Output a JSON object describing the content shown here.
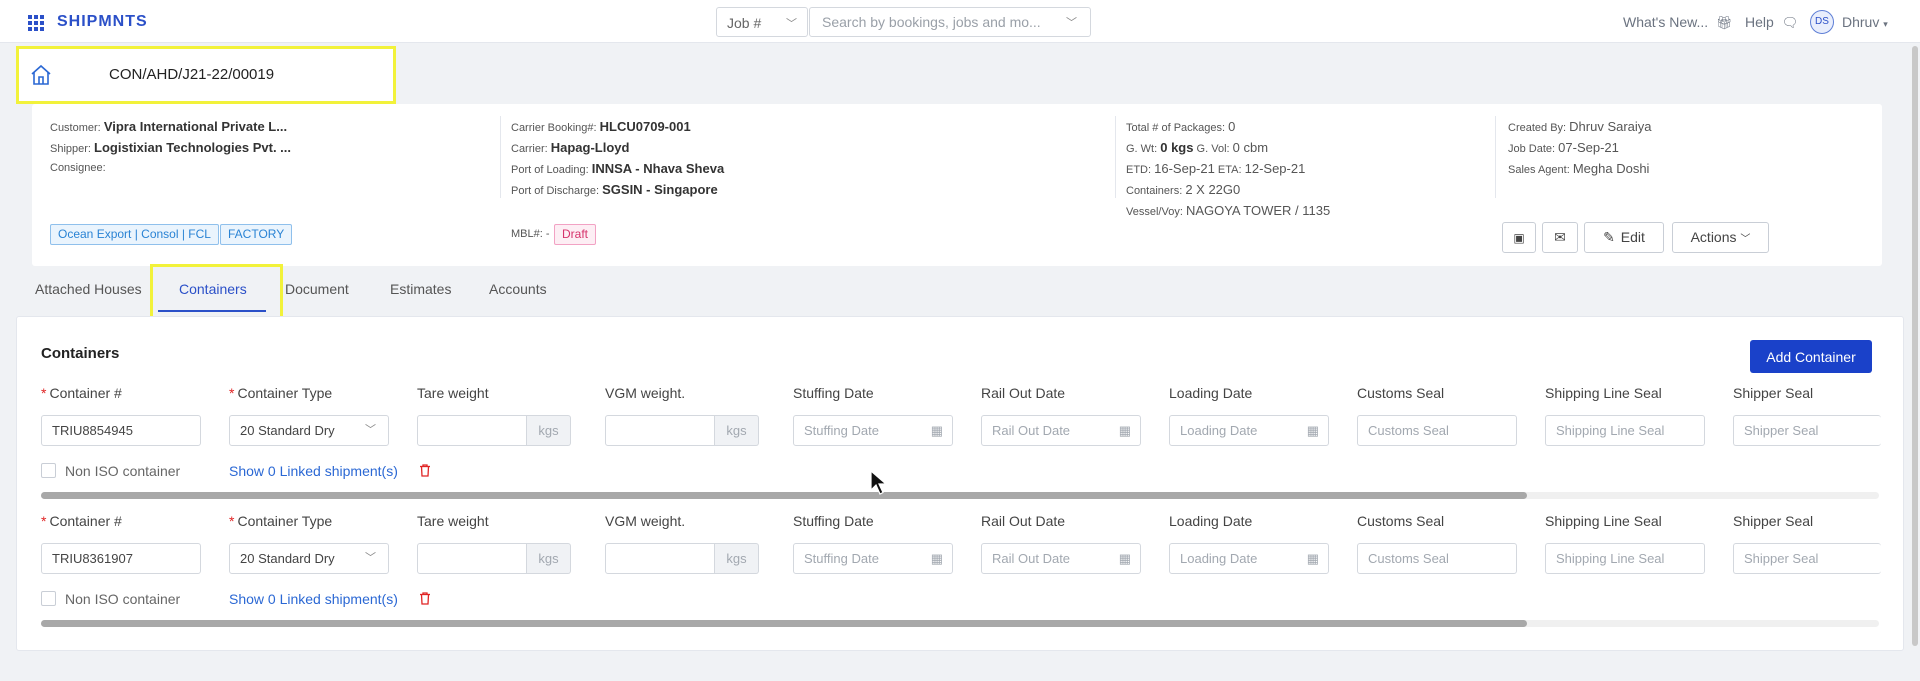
{
  "header": {
    "brand": "SHIPMNTS",
    "job_select": "Job #",
    "search_placeholder": "Search by bookings, jobs and mo...",
    "whats_new": "What's New...",
    "help": "Help",
    "avatar_initials": "DS",
    "user_name": "Dhruv"
  },
  "job": {
    "number": "CON/AHD/J21-22/00019"
  },
  "info": {
    "customer_label": "Customer:",
    "customer": "Vipra International Private L...",
    "shipper_label": "Shipper:",
    "shipper": "Logistixian Technologies Pvt. ...",
    "consignee_label": "Consignee:",
    "carrier_booking_label": "Carrier Booking#:",
    "carrier_booking": "HLCU0709-001",
    "carrier_label": "Carrier:",
    "carrier": "Hapag-Lloyd",
    "pol_label": "Port of Loading:",
    "pol": "INNSA - Nhava Sheva",
    "pod_label": "Port of Discharge:",
    "pod": "SGSIN - Singapore",
    "packages_label": "Total # of Packages:",
    "packages": "0",
    "gwt_label": "G. Wt:",
    "gwt": "0 kgs",
    "gvol_label": "G. Vol:",
    "gvol": "0 cbm",
    "etd_label": "ETD:",
    "etd": "16-Sep-21",
    "eta_label": "ETA:",
    "eta": "12-Sep-21",
    "containers_label": "Containers:",
    "containers": "2 X 22G0",
    "vessel_label": "Vessel/Voy:",
    "vessel": "NAGOYA TOWER / 1135",
    "created_by_label": "Created By:",
    "created_by": "Dhruv Saraiya",
    "job_date_label": "Job Date:",
    "job_date": "07-Sep-21",
    "sales_agent_label": "Sales Agent:",
    "sales_agent": "Megha Doshi",
    "tags": [
      "Ocean Export | Consol | FCL",
      "FACTORY"
    ],
    "mbl_label": "MBL#: -",
    "status": "Draft",
    "edit_label": "Edit",
    "actions_label": "Actions"
  },
  "tabs": [
    "Attached Houses",
    "Containers",
    "Document",
    "Estimates",
    "Accounts"
  ],
  "containers_panel": {
    "title": "Containers",
    "add_button": "Add Container",
    "labels": {
      "container_no": "Container #",
      "container_type": "Container Type",
      "tare": "Tare weight",
      "vgm": "VGM weight.",
      "stuffing": "Stuffing Date",
      "rail_out": "Rail Out Date",
      "loading": "Loading Date",
      "customs_seal": "Customs Seal",
      "shipping_line_seal": "Shipping Line Seal",
      "shipper_seal": "Shipper Seal"
    },
    "unit": "kgs",
    "non_iso": "Non ISO container",
    "linked": "Show 0 Linked shipment(s)",
    "rows": [
      {
        "container_no": "TRIU8854945",
        "container_type": "20 Standard Dry"
      },
      {
        "container_no": "TRIU8361907",
        "container_type": "20 Standard Dry"
      }
    ]
  }
}
